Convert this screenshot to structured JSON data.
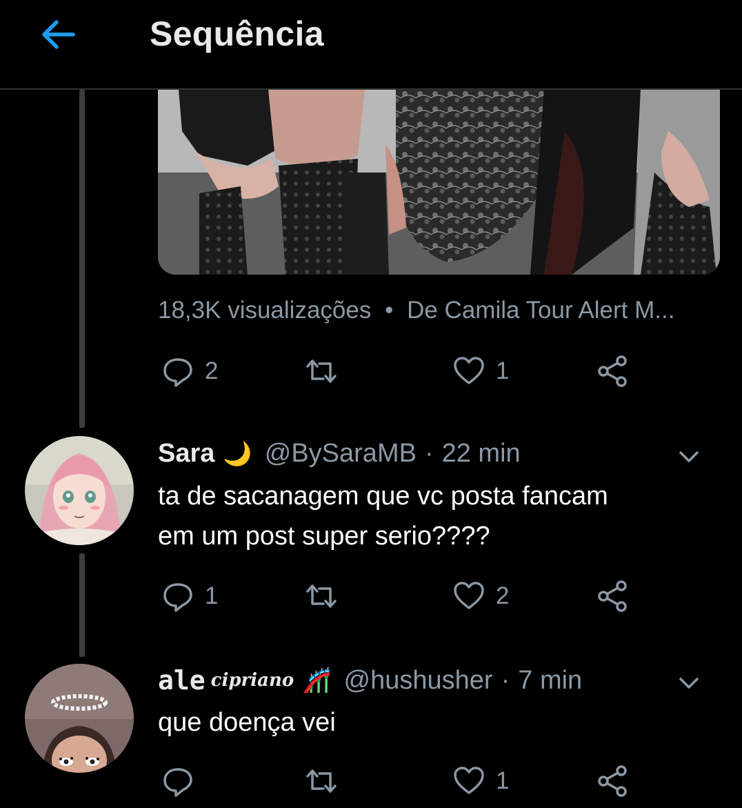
{
  "header": {
    "title": "Sequência",
    "back_icon": "arrow-left-icon",
    "accent": "#1d9bf0"
  },
  "media_tweet": {
    "meta_views": "18,3K visualizações",
    "meta_sep": "•",
    "meta_source": "De Camila Tour Alert M...",
    "actions": {
      "replies": "2",
      "retweets": "",
      "likes": "1"
    }
  },
  "replies": [
    {
      "display_name": "Sara",
      "name_emoji": "🌙",
      "handle": "@BySaraMB",
      "sep": "·",
      "time": "22 min",
      "text_line1": "ta de sacanagem que vc posta fancam",
      "text_line2": "em um post super serio????",
      "actions": {
        "replies": "1",
        "retweets": "",
        "likes": "2"
      }
    },
    {
      "display_name": "ale",
      "name_script": "cipriano",
      "name_emoji": "🎢",
      "handle": "@hushusher",
      "sep": "·",
      "time": "7 min",
      "text_line1": "que doença vei",
      "actions": {
        "replies": "",
        "retweets": "",
        "likes": "1"
      }
    }
  ],
  "colors": {
    "text_secondary": "#8b98a5",
    "thread_line": "#3a3d40",
    "divider": "#2f3336"
  }
}
